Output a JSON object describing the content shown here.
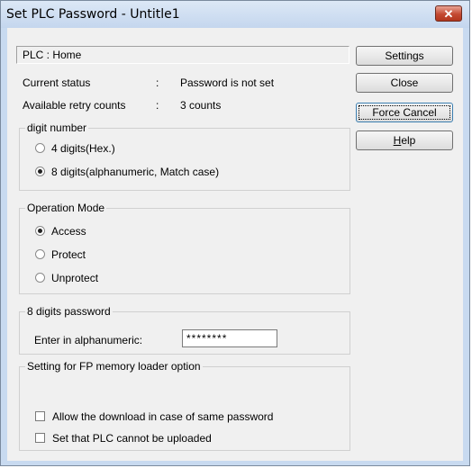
{
  "window": {
    "title": "Set PLC Password - Untitle1",
    "close_glyph": "✕"
  },
  "plc_bar": {
    "text": "PLC  :  Home"
  },
  "status": {
    "current_label": "Current status",
    "current_value": "Password is not set",
    "retry_label": "Available retry counts",
    "retry_value": "3 counts",
    "colon": ":"
  },
  "digit_number": {
    "title": "digit number",
    "options": [
      {
        "label": "4 digits(Hex.)",
        "checked": false
      },
      {
        "label": "8 digits(alphanumeric, Match case)",
        "checked": true
      }
    ]
  },
  "operation_mode": {
    "title": "Operation Mode",
    "options": [
      {
        "label": "Access",
        "checked": true
      },
      {
        "label": "Protect",
        "checked": false
      },
      {
        "label": "Unprotect",
        "checked": false
      }
    ]
  },
  "password": {
    "title": "8 digits password",
    "label": "Enter in alphanumeric:",
    "value": "********"
  },
  "fp_loader": {
    "title": "Setting for FP memory loader option",
    "options": [
      {
        "label": "Allow the download in case of same password",
        "checked": false
      },
      {
        "label": "Set that PLC cannot be uploaded",
        "checked": false
      }
    ]
  },
  "buttons": {
    "settings": "Settings",
    "close": "Close",
    "force_cancel": "Force Cancel",
    "help_first": "H",
    "help_rest": "elp"
  }
}
